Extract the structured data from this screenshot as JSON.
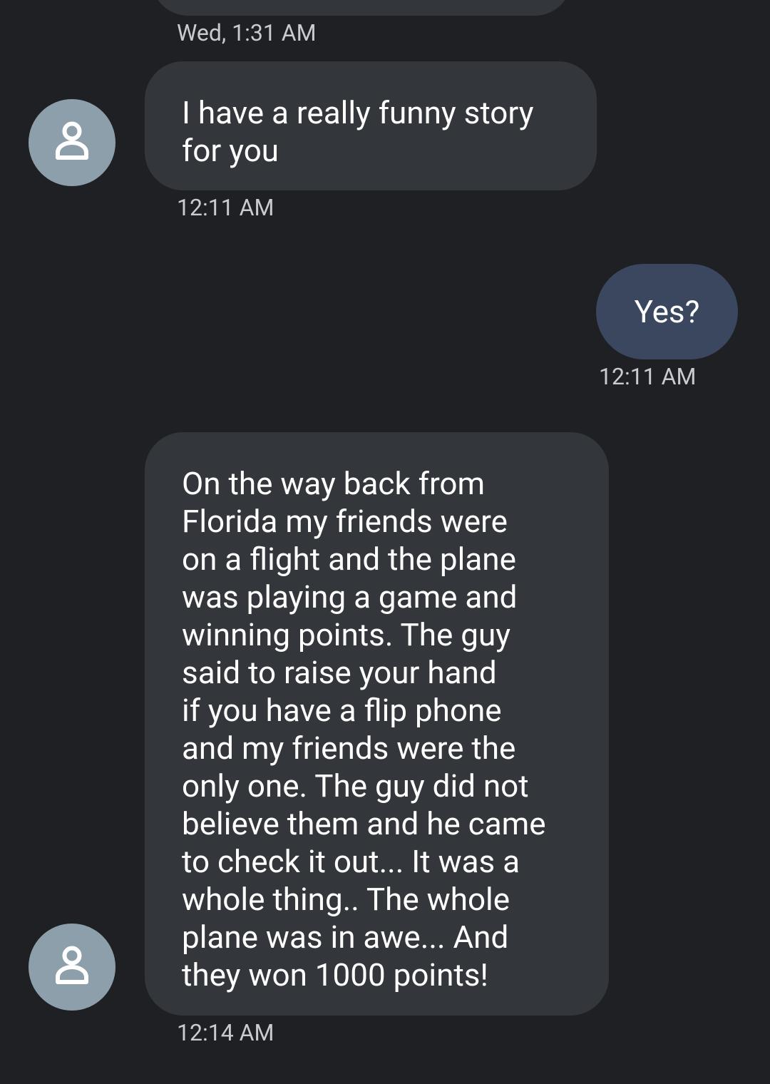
{
  "date_separator": "Wed, 1:31 AM",
  "messages": [
    {
      "direction": "incoming",
      "text": "I have a really funny story\nfor you",
      "time": "12:11 AM",
      "avatar_icon": "person-icon"
    },
    {
      "direction": "outgoing",
      "text": "Yes?",
      "time": "12:11 AM"
    },
    {
      "direction": "incoming",
      "text": "On the way back from\nFlorida my friends were\non a flight and the plane\nwas playing a game and\nwinning points. The guy\nsaid to raise your hand\nif you have a flip phone\nand my friends were the\nonly one. The guy did not\nbelieve them and he came\nto check it out... It was a\nwhole thing.. The whole\nplane was in awe... And\nthey won 1000 points!",
      "time": "12:14 AM",
      "avatar_icon": "person-icon"
    }
  ],
  "colors": {
    "background": "#1f2024",
    "incoming_bubble": "#33363a",
    "outgoing_bubble": "#3a475e",
    "avatar": "#8d9fab",
    "text": "#ffffff",
    "timestamp": "#c9cbce"
  }
}
